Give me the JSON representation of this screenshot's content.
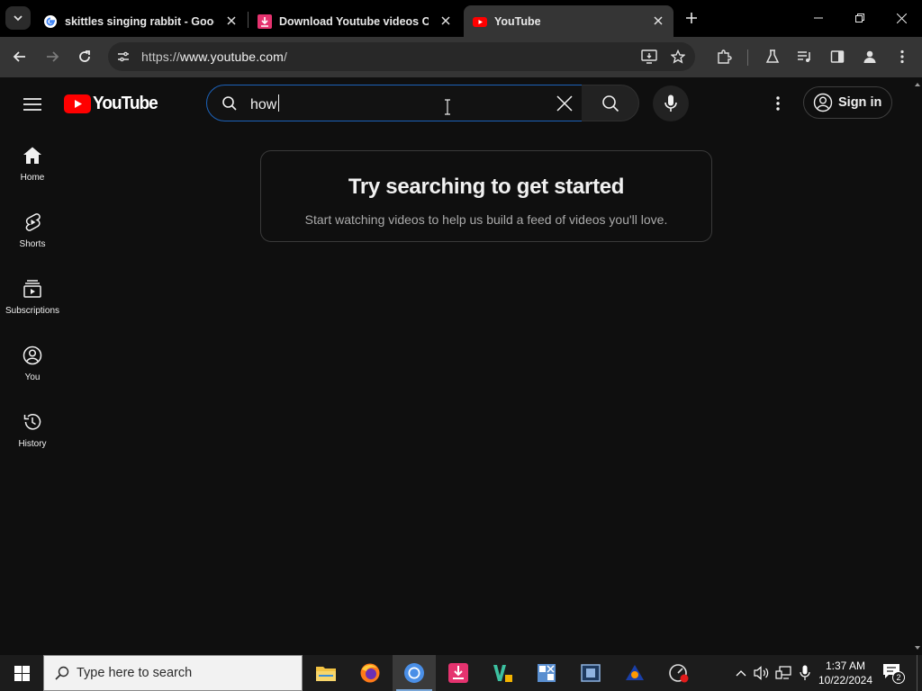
{
  "browser": {
    "tabs": [
      {
        "title": "skittles singing rabbit - Google",
        "favicon": "google-g-icon",
        "active": false
      },
      {
        "title": "Download Youtube videos Onl",
        "favicon": "download-site-icon",
        "active": false
      },
      {
        "title": "YouTube",
        "favicon": "youtube-icon",
        "active": true
      }
    ],
    "address": {
      "scheme": "https://",
      "host": "www.youtube.com",
      "path": "/"
    }
  },
  "youtube": {
    "logo_text": "YouTube",
    "search": {
      "query": "how"
    },
    "sign_in_label": "Sign in",
    "guide": [
      {
        "label": "Home",
        "icon": "home-icon"
      },
      {
        "label": "Shorts",
        "icon": "shorts-icon"
      },
      {
        "label": "Subscriptions",
        "icon": "subscriptions-icon"
      },
      {
        "label": "You",
        "icon": "account-icon"
      },
      {
        "label": "History",
        "icon": "history-icon"
      }
    ],
    "prompt": {
      "title": "Try searching to get started",
      "subtitle": "Start watching videos to help us build a feed of videos you'll love."
    },
    "colors": {
      "brand_red": "#ff0000",
      "background": "#0f0f0f",
      "focus_blue": "#1c62b9"
    }
  },
  "taskbar": {
    "search_placeholder": "Type here to search",
    "time": "1:37 AM",
    "date": "10/22/2024",
    "notification_count": "2"
  }
}
